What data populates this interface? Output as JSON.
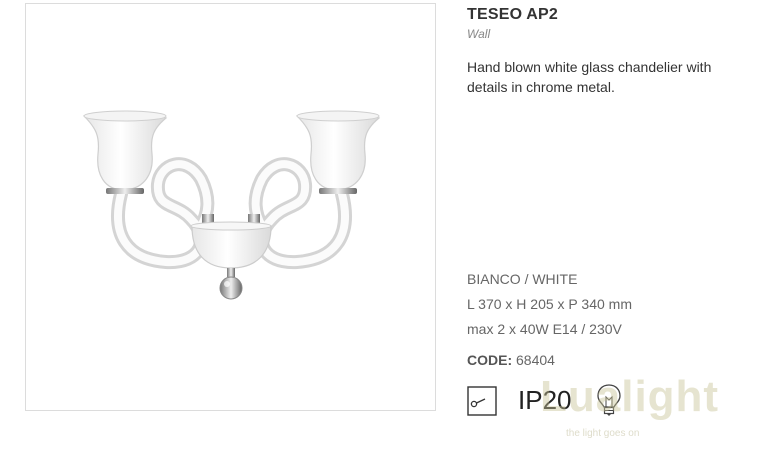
{
  "product": {
    "title": "TESEO AP2",
    "category": "Wall",
    "description": "Hand blown white glass chandelier with details in chrome metal.",
    "finish": "BIANCO / WHITE",
    "dimensions": "L 370 x H 205 x P 340 mm",
    "power": "max 2 x 40W E14 / 230V",
    "code_label": "CODE:",
    "code_value": "68404",
    "ip_rating": "IP20"
  },
  "icons": {
    "switch": "switch-icon",
    "bulb": "bulb-icon"
  },
  "watermark": {
    "brand": "Lualight",
    "tagline": "the light goes on"
  },
  "colors": {
    "title": "#333333",
    "text": "#666666",
    "frame_border": "#dcdcdc",
    "watermark": "#c8c496"
  }
}
